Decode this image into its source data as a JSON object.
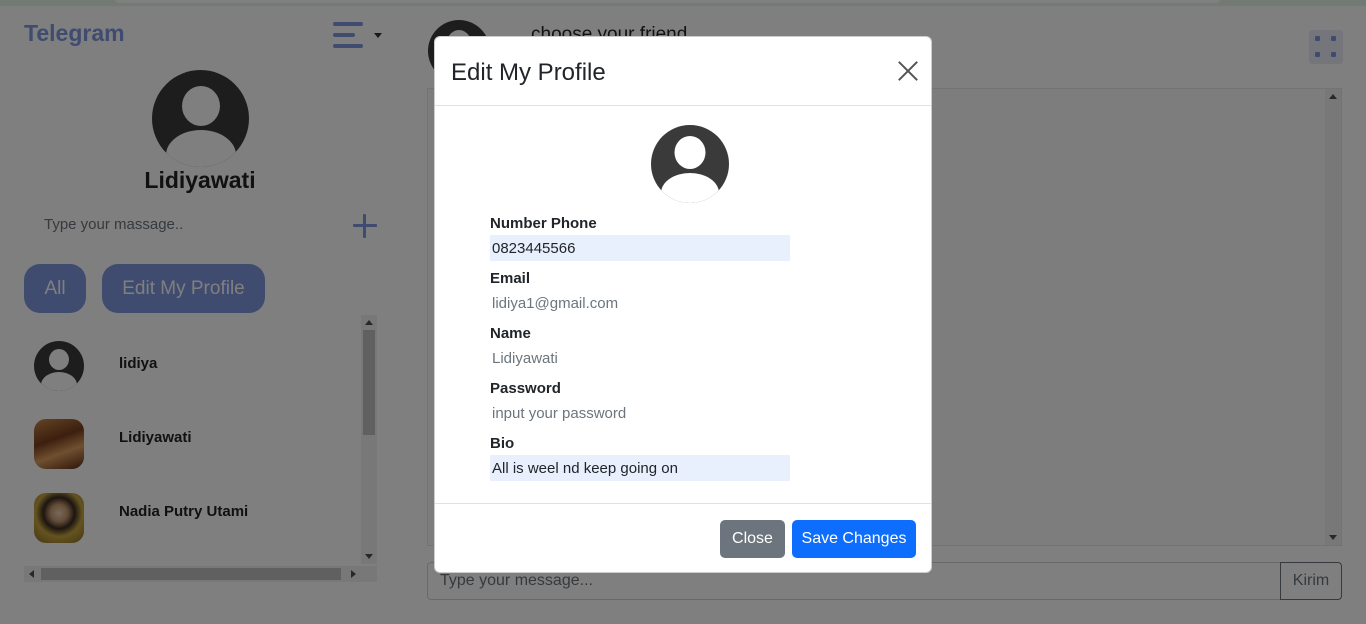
{
  "sidebar": {
    "brand": "Telegram",
    "profile_name": "Lidiyawati",
    "search_placeholder": "Type your massage..",
    "tabs": [
      {
        "label": "All"
      },
      {
        "label": "Edit My Profile"
      }
    ],
    "chats": [
      {
        "name": "lidiya",
        "avatar": "default-avatar"
      },
      {
        "name": "Lidiyawati",
        "avatar": "food-photo"
      },
      {
        "name": "Nadia Putry Utami",
        "avatar": "person-photo"
      }
    ]
  },
  "main": {
    "header_title": "choose your friend",
    "input_placeholder": "Type your message...",
    "send_label": "Kirim"
  },
  "modal": {
    "title": "Edit My Profile",
    "fields": [
      {
        "label": "Number Phone",
        "value": "0823445566",
        "placeholder": ""
      },
      {
        "label": "Email",
        "value": "",
        "placeholder": "lidiya1@gmail.com"
      },
      {
        "label": "Name",
        "value": "",
        "placeholder": "Lidiyawati"
      },
      {
        "label": "Password",
        "value": "",
        "placeholder": "input your password"
      },
      {
        "label": "Bio",
        "value": "All is weel nd keep going on",
        "placeholder": ""
      }
    ],
    "close_label": "Close",
    "save_label": "Save Changes"
  },
  "colors": {
    "accent": "#7E98DF",
    "primary": "#0d6efd",
    "secondary": "#6c757d",
    "backdrop": "rgba(0,0,0,0.5)"
  }
}
